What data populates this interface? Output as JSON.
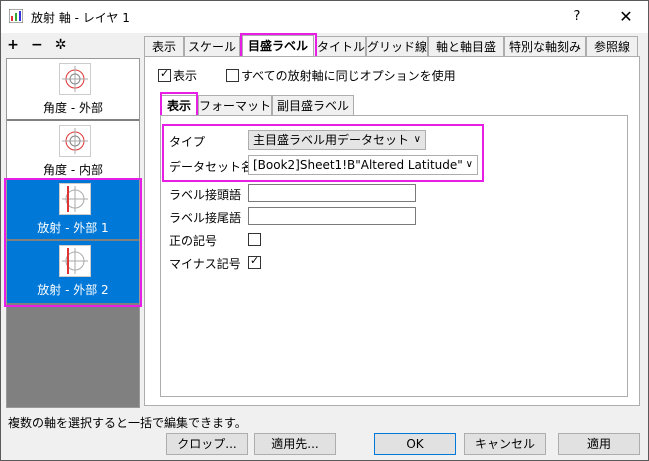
{
  "window": {
    "title": "放射 軸 - レイヤ 1",
    "help_label": "?",
    "close_label": "✕"
  },
  "left_toolbar": {
    "add_label": "+",
    "remove_label": "−",
    "settings_label": "✲"
  },
  "axes": [
    {
      "label": "角度 - 外部",
      "selected": false
    },
    {
      "label": "角度 - 内部",
      "selected": false
    },
    {
      "label": "放射 - 外部 1",
      "selected": true
    },
    {
      "label": "放射 - 外部 2",
      "selected": true
    }
  ],
  "tabs": [
    "表示",
    "スケール",
    "目盛ラベル",
    "タイトル",
    "グリッド線",
    "軸と軸目盛",
    "特別な軸刻み",
    "参照線"
  ],
  "active_tab": "目盛ラベル",
  "options": {
    "show_label": "表示",
    "show_checked": true,
    "same_option_label": "すべての放射軸に同じオプションを使用",
    "same_option_checked": false
  },
  "subtabs": [
    "表示",
    "フォーマット",
    "副目盛ラベル"
  ],
  "form": {
    "type_label": "タイプ",
    "type_value": "主目盛ラベル用データセット",
    "dataset_label": "データセット名",
    "dataset_value": "[Book2]Sheet1!B\"Altered Latitude\"",
    "prefix_label": "ラベル接頭語",
    "prefix_value": "",
    "suffix_label": "ラベル接尾語",
    "suffix_value": "",
    "plus_sign_label": "正の記号",
    "plus_sign_checked": false,
    "minus_sign_label": "マイナス記号",
    "minus_sign_checked": true
  },
  "status_text": "複数の軸を選択すると一括で編集できます。",
  "buttons": {
    "crop": "クロップ...",
    "apply_to": "適用先...",
    "ok": "OK",
    "cancel": "キャンセル",
    "apply": "適用"
  },
  "colors": {
    "highlight": "#e61ee6",
    "selection": "#0078d7"
  }
}
